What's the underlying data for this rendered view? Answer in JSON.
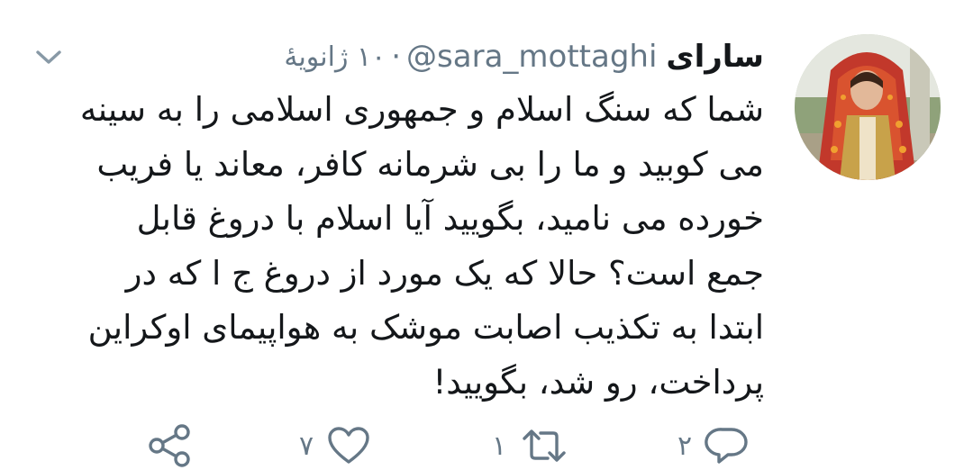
{
  "tweet": {
    "display_name": "سارای",
    "handle": "@sara_mottaghi",
    "separator": "·",
    "timestamp": "۱۰ ژانویهٔ",
    "lines": [
      "شما که سنگ اسلام و جمهوری اسلامی را به سینه",
      "می کوبید و ما را بی شرمانه کافر، معاند یا فریب",
      "خورده می نامید، بگویید آیا اسلام با دروغ قابل",
      "جمع است؟ حالا که یک مورد از دروغ ج ا که در",
      "ابتدا به  تکذیب اصابت موشک به هواپیمای اوکراین",
      "پرداخت، رو شد، بگویید!"
    ]
  },
  "actions": {
    "reply_count": "۲",
    "retweet_count": "۱",
    "like_count": "۷"
  },
  "icons": {
    "avatar": "avatar-photo",
    "caret": "chevron-down-icon",
    "reply": "reply-icon",
    "retweet": "retweet-icon",
    "like": "heart-icon",
    "share": "share-icon"
  },
  "colors": {
    "text_primary": "#14171a",
    "text_secondary": "#657786",
    "background": "#ffffff"
  }
}
